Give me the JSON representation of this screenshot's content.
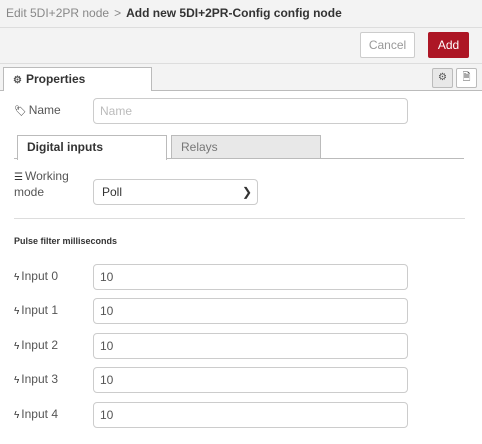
{
  "breadcrumb": {
    "parent": "Edit 5DI+2PR node",
    "separator": ">",
    "current": "Add new 5DI+2PR-Config config node"
  },
  "toolbar": {
    "cancel_label": "Cancel",
    "add_label": "Add"
  },
  "tabs": {
    "properties_label": "Properties"
  },
  "form": {
    "name_label": "Name",
    "name_placeholder": "Name",
    "name_value": "",
    "subtabs": [
      {
        "label": "Digital inputs"
      },
      {
        "label": "Relays"
      }
    ],
    "working_mode_label_1": "Working",
    "working_mode_label_2": "mode",
    "working_mode_value": "Poll",
    "pulse_title": "Pulse filter milliseconds",
    "inputs": [
      {
        "label": "Input 0",
        "value": "10"
      },
      {
        "label": "Input 1",
        "value": "10"
      },
      {
        "label": "Input 2",
        "value": "10"
      },
      {
        "label": "Input 3",
        "value": "10"
      },
      {
        "label": "Input 4",
        "value": "10"
      }
    ]
  },
  "colors": {
    "accent": "#ad1625",
    "header_bg": "#f3f3f3"
  },
  "icons": {
    "tab_icon": "gear-icon",
    "name_icon": "tag-icon",
    "mode_icon": "bars-icon",
    "input_icon": "bolt-icon"
  }
}
